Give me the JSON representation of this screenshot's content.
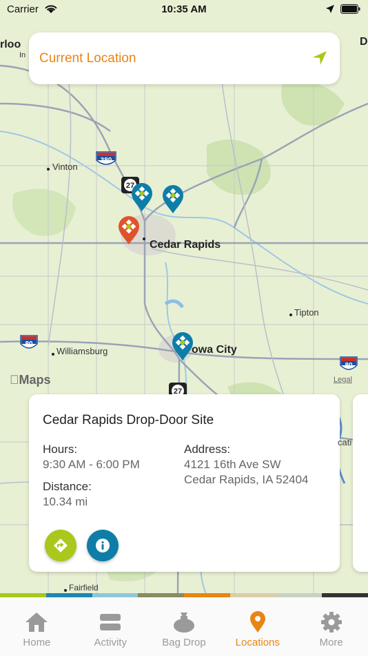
{
  "status_bar": {
    "carrier": "Carrier",
    "time": "10:35 AM"
  },
  "location_search": {
    "label": "Current Location"
  },
  "map": {
    "labels": {
      "edge_left_1": "rloo",
      "edge_left_2": "In",
      "edge_right": "D",
      "vinton": "Vinton",
      "cedar_rapids": "Cedar Rapids",
      "tipton": "Tipton",
      "williamsburg": "Williamsburg",
      "iowa_city": "owa City",
      "fairfield": "Fairfield",
      "next_card_peek": "cati"
    },
    "shields": {
      "i380": "380",
      "us27_top": "27",
      "us27_bottom": "27",
      "i80_left": "80",
      "i80_right": "80"
    },
    "attribution": {
      "logo": "Maps",
      "legal": "Legal"
    }
  },
  "location_card": {
    "name": "Cedar Rapids Drop-Door Site",
    "hours_label": "Hours:",
    "hours": "9:30 AM - 6:00 PM",
    "distance_label": "Distance:",
    "distance": "10.34 mi",
    "address_label": "Address:",
    "address_line1": "4121 16th Ave SW",
    "address_line2": "Cedar Rapids, IA 52404"
  },
  "strip_colors": [
    "#a8c81c",
    "#1b87b4",
    "#8fc7d8",
    "#8a8a64",
    "#e88515",
    "#d9cfa8",
    "#c7d2c2",
    "#333333"
  ],
  "colors": {
    "accent": "#e88515",
    "green": "#a8c81c",
    "blue": "#0e7ea8",
    "pin_red": "#e0532a"
  },
  "tabs": [
    {
      "label": "Home",
      "icon": "home-icon"
    },
    {
      "label": "Activity",
      "icon": "activity-icon"
    },
    {
      "label": "Bag Drop",
      "icon": "bag-icon"
    },
    {
      "label": "Locations",
      "icon": "location-pin-icon",
      "active": true
    },
    {
      "label": "More",
      "icon": "gear-icon"
    }
  ]
}
